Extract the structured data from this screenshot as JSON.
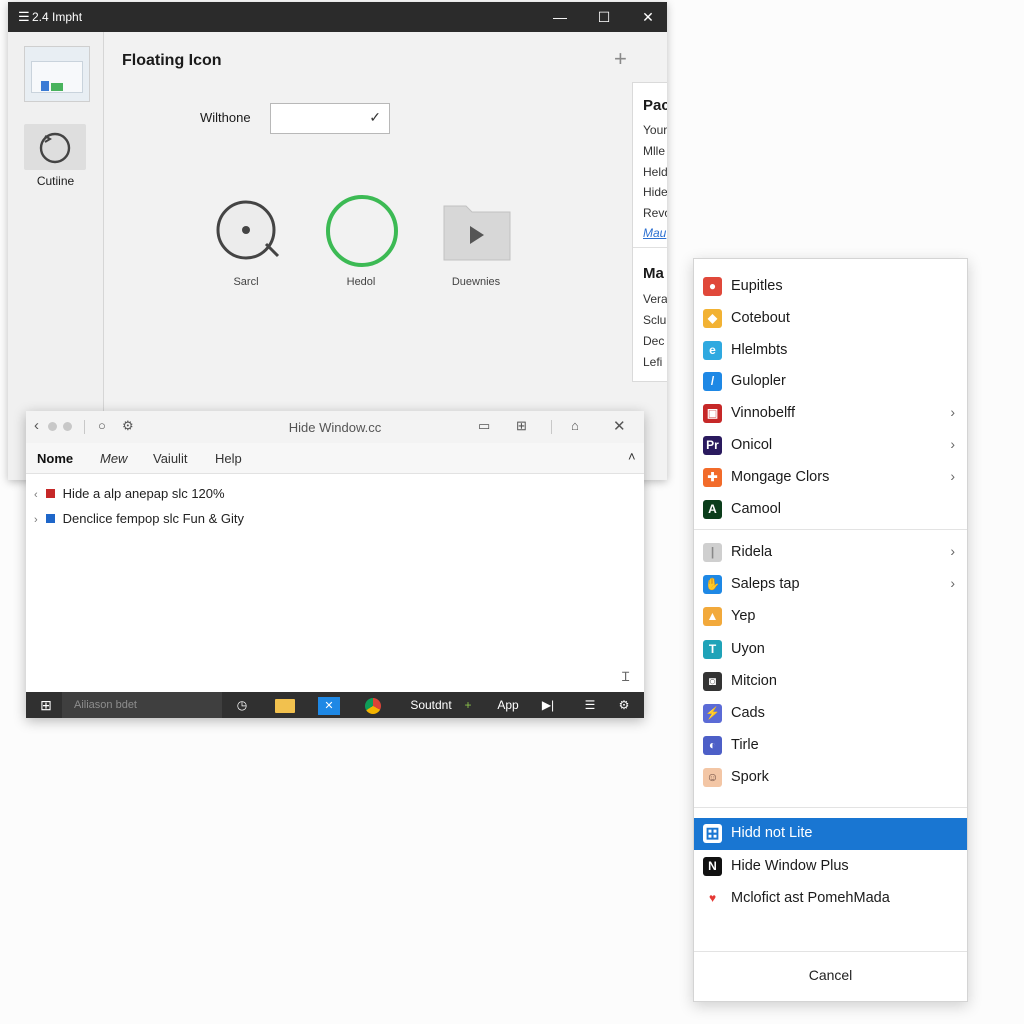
{
  "window1": {
    "title": "2.4 Impht",
    "controls": {
      "minimize": "—",
      "maximize": "☐",
      "close": "✕"
    },
    "sidebar": {
      "thumb_label": "Cutiine"
    },
    "heading": "Floating Icon",
    "plus": "+",
    "field": {
      "label": "Wilthone",
      "value": ""
    },
    "icons": [
      {
        "label": "Sarcl"
      },
      {
        "label": "Hedol"
      },
      {
        "label": "Duewnies"
      }
    ],
    "right_panel": {
      "sections": [
        {
          "heading": "Pac",
          "lines": [
            "Your",
            "Mlle",
            "Held",
            "Hide",
            "Revo"
          ],
          "link": "Mau"
        },
        {
          "heading": "Ma",
          "lines": [
            "Vera",
            "Sclu",
            "Dec",
            "Lefi"
          ]
        }
      ]
    }
  },
  "window2": {
    "title": "Hide Window.cc",
    "menu": [
      "Nome",
      "Mew",
      "Vaiulit",
      "Help"
    ],
    "tree": [
      {
        "label": "Hide a alp anepap slc 120%",
        "color": "#c62828"
      },
      {
        "label": "Denclice fempop slc Fun & Gity",
        "color": "#1e66c9"
      }
    ],
    "scroll_glyph": "Ɪ",
    "taskbar": {
      "search": "Ailiason bdet",
      "sound_label": "Soutdnt",
      "app_label": "App"
    }
  },
  "context_menu": {
    "groups": [
      [
        {
          "label": "Eupitles",
          "icon": "app-red-icon",
          "color": "#e0483a",
          "glyph": "●"
        },
        {
          "label": "Cotebout",
          "icon": "app-yellow-icon",
          "color": "#f2b233",
          "glyph": "◆"
        },
        {
          "label": "Hlelmbts",
          "icon": "edge-icon",
          "color": "#2fa9e0",
          "glyph": "e"
        },
        {
          "label": "Gulopler",
          "icon": "pen-icon",
          "color": "#1e88e5",
          "glyph": "/"
        },
        {
          "label": "Vinnobelff",
          "icon": "app-crimson-icon",
          "color": "#c62828",
          "glyph": "▣",
          "submenu": true
        },
        {
          "label": "Onicol",
          "icon": "premiere-icon",
          "color": "#2a1a5e",
          "glyph": "Pr",
          "submenu": true
        },
        {
          "label": "Mongage Clors",
          "icon": "tools-icon",
          "color": "#f26b2a",
          "glyph": "✚",
          "submenu": true
        },
        {
          "label": "Camool",
          "icon": "terminal-icon",
          "color": "#0b3d1b",
          "glyph": "A"
        }
      ],
      [
        {
          "label": "Ridela",
          "icon": "app-gray-icon",
          "color": "#cfcfcf",
          "glyph": "|",
          "submenu": true
        },
        {
          "label": "Saleps tap",
          "icon": "hand-icon",
          "color": "#1e88e5",
          "glyph": "✋",
          "submenu": true
        },
        {
          "label": "Yep",
          "icon": "app-amber-icon",
          "color": "#f2a93b",
          "glyph": "▲"
        },
        {
          "label": "Uyon",
          "icon": "t-icon",
          "color": "#1fa3b8",
          "glyph": "T"
        },
        {
          "label": "Mitcion",
          "icon": "mic-icon",
          "color": "#333333",
          "glyph": "◙"
        },
        {
          "label": "Cads",
          "icon": "cads-icon",
          "color": "#5b6bd6",
          "glyph": "⚡"
        },
        {
          "label": "Tirle",
          "icon": "tirle-icon",
          "color": "#4d5fc7",
          "glyph": "◐"
        },
        {
          "label": "Spork",
          "icon": "face-icon",
          "color": "#f3c6a5",
          "glyph": "☺"
        }
      ],
      [
        {
          "label": "Hidd not Lite",
          "icon": "windows-icon",
          "color": "#ffffff",
          "glyph": "⊞",
          "selected": true
        },
        {
          "label": "Hide Window Plus",
          "icon": "netflix-icon",
          "color": "#111111",
          "glyph": "N"
        },
        {
          "label": "Mclofict ast PomehMada",
          "icon": "heart-icon",
          "color": "#ffffff",
          "glyph": "♥"
        }
      ]
    ],
    "cancel": "Cancel",
    "submenu_arrow": "›"
  },
  "colors": {
    "accent": "#1976d2",
    "green_ring": "#3cba54",
    "titlebar_dark": "#2b2b2b"
  }
}
